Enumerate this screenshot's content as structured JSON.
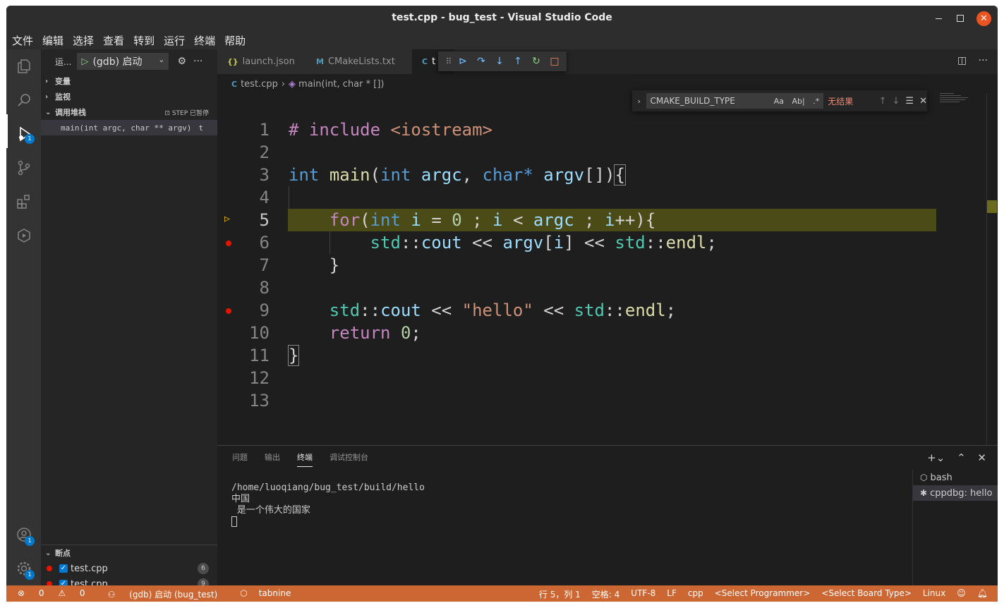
{
  "window": {
    "title": "test.cpp - bug_test - Visual Studio Code"
  },
  "menu": [
    "文件",
    "编辑",
    "选择",
    "查看",
    "转到",
    "运行",
    "终端",
    "帮助"
  ],
  "activity_badges": {
    "debug": "1",
    "accounts": "1",
    "settings": "1"
  },
  "sidebar": {
    "view_title": "运...",
    "run_config": "(gdb) 启动",
    "sections": {
      "variables": "变量",
      "watch": "监视",
      "call_stack": "调用堆栈",
      "call_stack_status": "STEP 已暂停",
      "breakpoints": "断点"
    },
    "stack_frame": "main(int argc, char ** argv)",
    "stack_frame_tail": "t",
    "breakpoints": [
      {
        "file": "test.cpp",
        "line": "6"
      },
      {
        "file": "test.cpp",
        "line": "9"
      }
    ]
  },
  "tabs": [
    {
      "icon": "{}",
      "label": "launch.json"
    },
    {
      "icon": "M",
      "label": "CMakeLists.txt"
    },
    {
      "icon": "C",
      "label": "t"
    }
  ],
  "breadcrumb": {
    "file": "test.cpp",
    "symbol": "main(int, char * [])"
  },
  "find": {
    "query": "CMAKE_BUILD_TYPE",
    "match_case": "Aa",
    "whole_word": "Ab|",
    "regex": ".*",
    "result": "无结果"
  },
  "code": {
    "line_numbers": [
      "1",
      "2",
      "3",
      "4",
      "5",
      "6",
      "7",
      "8",
      "9",
      "10",
      "11",
      "12",
      "13"
    ],
    "current_line": 5,
    "breakpoint_lines": [
      6,
      9
    ]
  },
  "panel": {
    "tabs": [
      "问题",
      "输出",
      "终端",
      "调试控制台"
    ],
    "active_tab": "终端",
    "terminal_lines": [
      "/home/luoqiang/bug_test/build/hello",
      "中国",
      " 是一个伟大的国家"
    ],
    "terminals": [
      "bash",
      "cppdbg: hello"
    ]
  },
  "status": {
    "errors": "0",
    "warnings": "0",
    "debug": "(gdb) 启动 (bug_test)",
    "tabnine": "tabnine",
    "position": "行 5，列 1",
    "spaces": "空格: 4",
    "encoding": "UTF-8",
    "eol": "LF",
    "language": "cpp",
    "programmer": "<Select Programmer>",
    "board": "<Select Board Type>",
    "platform": "Linux"
  },
  "colors": {
    "statusbar_debug": "#cc6633",
    "current_line_highlight": "#4b4b18",
    "breakpoint": "#e51400",
    "accent": "#007acc"
  }
}
